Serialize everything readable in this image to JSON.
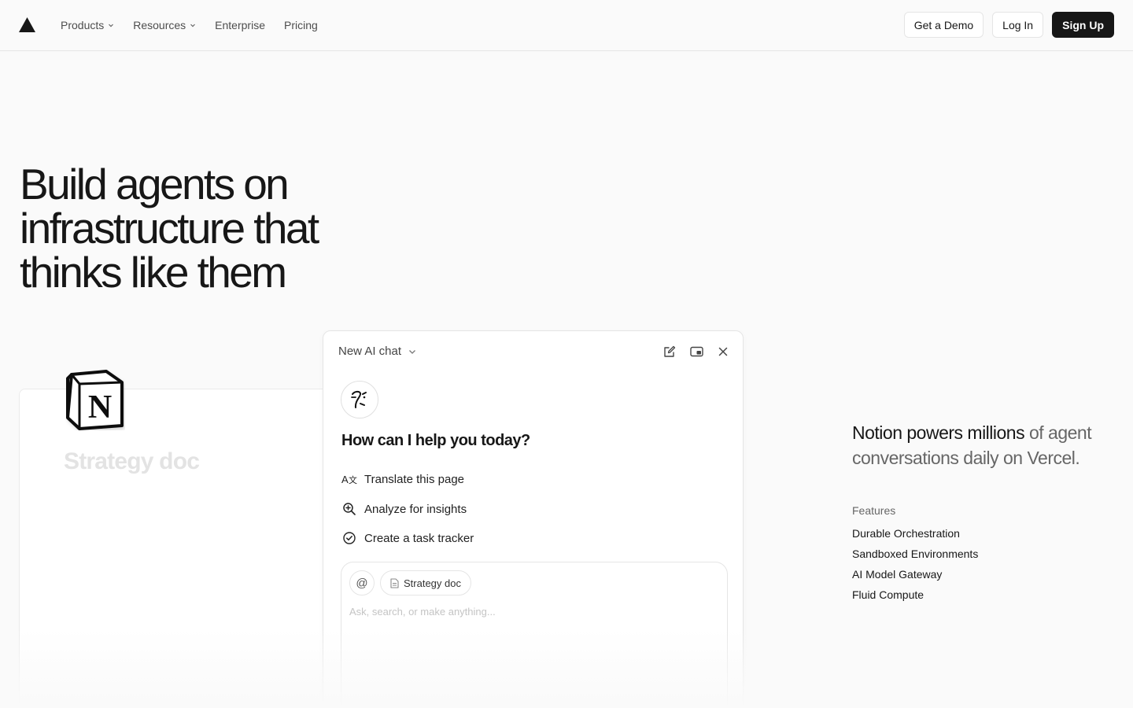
{
  "nav": {
    "logo": "vercel-triangle-icon",
    "items": [
      {
        "label": "Products",
        "has_dropdown": true
      },
      {
        "label": "Resources",
        "has_dropdown": true
      },
      {
        "label": "Enterprise",
        "has_dropdown": false
      },
      {
        "label": "Pricing",
        "has_dropdown": false
      }
    ],
    "actions": {
      "demo": "Get a Demo",
      "login": "Log In",
      "signup": "Sign Up"
    }
  },
  "hero": {
    "title_line1": "Build agents on",
    "title_line2": "infrastructure that",
    "title_line3": "thinks like them"
  },
  "doc": {
    "title": "Strategy doc"
  },
  "chat": {
    "header": "New AI chat",
    "question": "How can I help you today?",
    "suggestions": [
      {
        "label": "Translate this page",
        "icon": "translate-icon"
      },
      {
        "label": "Analyze for insights",
        "icon": "zoom-in-icon"
      },
      {
        "label": "Create a task tracker",
        "icon": "check-circle-icon"
      }
    ],
    "composer": {
      "mention": "@",
      "chip": "Strategy doc",
      "placeholder": "Ask, search, or make anything..."
    }
  },
  "info": {
    "strong": "Notion powers millions",
    "muted": " of agent conversations daily on Vercel.",
    "features_label": "Features",
    "features": [
      "Durable Orchestration",
      "Sandboxed Environments",
      "AI Model Gateway",
      "Fluid Compute"
    ]
  },
  "colors": {
    "background": "#fafafa",
    "text": "#171717",
    "muted": "#666666",
    "border": "#e5e5e5",
    "primary_button": "#171717"
  }
}
